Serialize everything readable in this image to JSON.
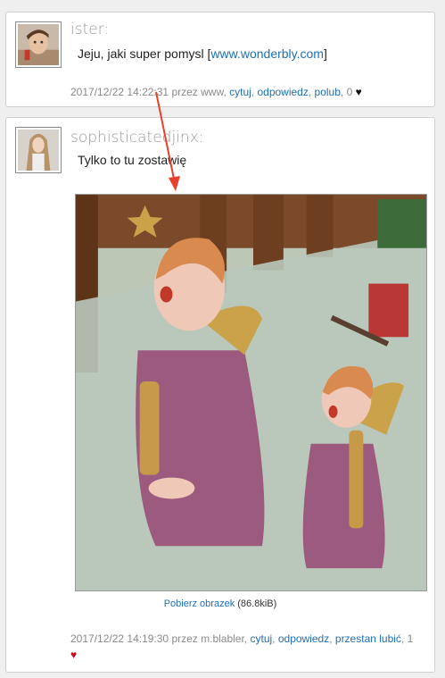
{
  "comments": [
    {
      "author": "ister:",
      "body_prefix": "Jeju, jaki super pomysl [",
      "body_link": "www.wonderbly.com",
      "body_suffix": "]",
      "meta_prefix": "2017/12/22 14:22:31 przez www, ",
      "actions": [
        "cytuj",
        "odpowiedz",
        "polub"
      ],
      "likes": "0",
      "heart": "♥",
      "heart_color": "#111111"
    },
    {
      "author": "sophisticatedjinx:",
      "body": "Tylko to tu zostawię",
      "download_link": "Pobierz obrazek",
      "download_size": "(86.8kiB)",
      "meta_prefix": "2017/12/22 14:19:30 przez m.blabler, ",
      "actions": [
        "cytuj",
        "odpowiedz",
        "przestan lubić"
      ],
      "likes": "1",
      "heart": "♥",
      "heart_color": "#d0021b"
    }
  ],
  "colors": {
    "link": "#1f6fb5",
    "annotation_arrow": "#e8402a"
  },
  "icons": [
    "avatar-photo",
    "angel-figurines-photo",
    "heart-icon",
    "red-annotation-arrow"
  ]
}
